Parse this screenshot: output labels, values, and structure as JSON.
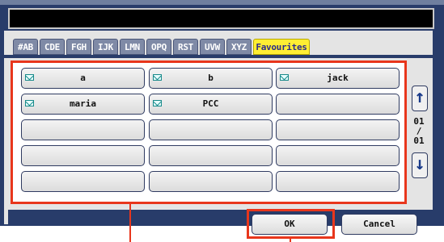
{
  "tabs": [
    "#AB",
    "CDE",
    "FGH",
    "IJK",
    "LMN",
    "OPQ",
    "RST",
    "UVW",
    "XYZ",
    "Favourites"
  ],
  "active_tab": "Favourites",
  "destinations": [
    {
      "label": "a",
      "has_email_icon": true
    },
    {
      "label": "b",
      "has_email_icon": true
    },
    {
      "label": "jack",
      "has_email_icon": true
    },
    {
      "label": "maria",
      "has_email_icon": true
    },
    {
      "label": "PCC",
      "has_email_icon": true
    },
    {
      "label": "",
      "has_email_icon": false
    },
    {
      "label": "",
      "has_email_icon": false
    },
    {
      "label": "",
      "has_email_icon": false
    },
    {
      "label": "",
      "has_email_icon": false
    },
    {
      "label": "",
      "has_email_icon": false
    },
    {
      "label": "",
      "has_email_icon": false
    },
    {
      "label": "",
      "has_email_icon": false
    },
    {
      "label": "",
      "has_email_icon": false
    },
    {
      "label": "",
      "has_email_icon": false
    },
    {
      "label": "",
      "has_email_icon": false
    }
  ],
  "pagination": {
    "current": "01",
    "separator": "/",
    "total": "01"
  },
  "buttons": {
    "ok": "OK",
    "cancel": "Cancel"
  },
  "icons": {
    "up": "arrow-up-icon",
    "down": "arrow-down-icon",
    "email": "envelope-icon"
  },
  "colors": {
    "panel": "#283c6a",
    "active_tab": "#ffee33",
    "highlight": "#e8361c"
  }
}
